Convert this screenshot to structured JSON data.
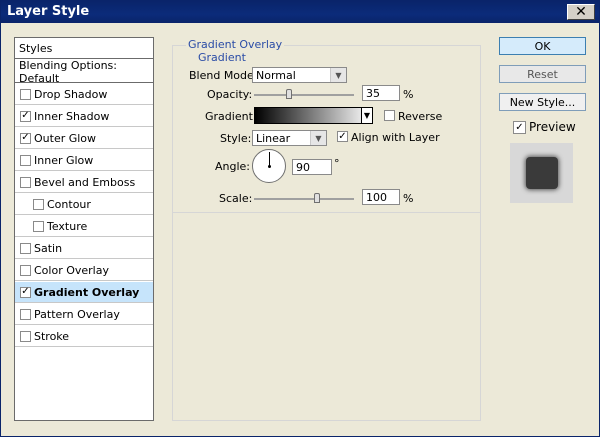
{
  "window": {
    "title": "Layer Style",
    "close_symbol": "✕"
  },
  "styles_list": {
    "header": "Styles",
    "blending_options": "Blending Options: Default",
    "items": [
      {
        "label": "Drop Shadow",
        "checked": false,
        "indent": false,
        "selected": false
      },
      {
        "label": "Inner Shadow",
        "checked": true,
        "indent": false,
        "selected": false
      },
      {
        "label": "Outer Glow",
        "checked": true,
        "indent": false,
        "selected": false
      },
      {
        "label": "Inner Glow",
        "checked": false,
        "indent": false,
        "selected": false
      },
      {
        "label": "Bevel and Emboss",
        "checked": false,
        "indent": false,
        "selected": false
      },
      {
        "label": "Contour",
        "checked": false,
        "indent": true,
        "selected": false
      },
      {
        "label": "Texture",
        "checked": false,
        "indent": true,
        "selected": false
      },
      {
        "label": "Satin",
        "checked": false,
        "indent": false,
        "selected": false
      },
      {
        "label": "Color Overlay",
        "checked": false,
        "indent": false,
        "selected": false
      },
      {
        "label": "Gradient Overlay",
        "checked": true,
        "indent": false,
        "selected": true
      },
      {
        "label": "Pattern Overlay",
        "checked": false,
        "indent": false,
        "selected": false
      },
      {
        "label": "Stroke",
        "checked": false,
        "indent": false,
        "selected": false
      }
    ]
  },
  "gradient_overlay": {
    "group_title": "Gradient Overlay",
    "sub_title": "Gradient",
    "blend_mode_label": "Blend Mode:",
    "blend_mode_value": "Normal",
    "opacity_label": "Opacity:",
    "opacity_value": "35",
    "opacity_unit": "%",
    "opacity_fraction": 0.35,
    "gradient_label": "Gradient:",
    "reverse_label": "Reverse",
    "reverse_checked": false,
    "style_label": "Style:",
    "style_value": "Linear",
    "align_label": "Align with Layer",
    "align_checked": true,
    "angle_label": "Angle:",
    "angle_value": "90",
    "angle_unit": "°",
    "scale_label": "Scale:",
    "scale_value": "100",
    "scale_unit": "%",
    "scale_fraction": 0.5
  },
  "buttons": {
    "ok": "OK",
    "reset": "Reset",
    "new_style": "New Style...",
    "preview_label": "Preview",
    "preview_checked": true
  },
  "colors": {
    "title_bar": "#0a246a",
    "group_title": "#2a4ca6",
    "selected_row": "#c6e4fb"
  }
}
